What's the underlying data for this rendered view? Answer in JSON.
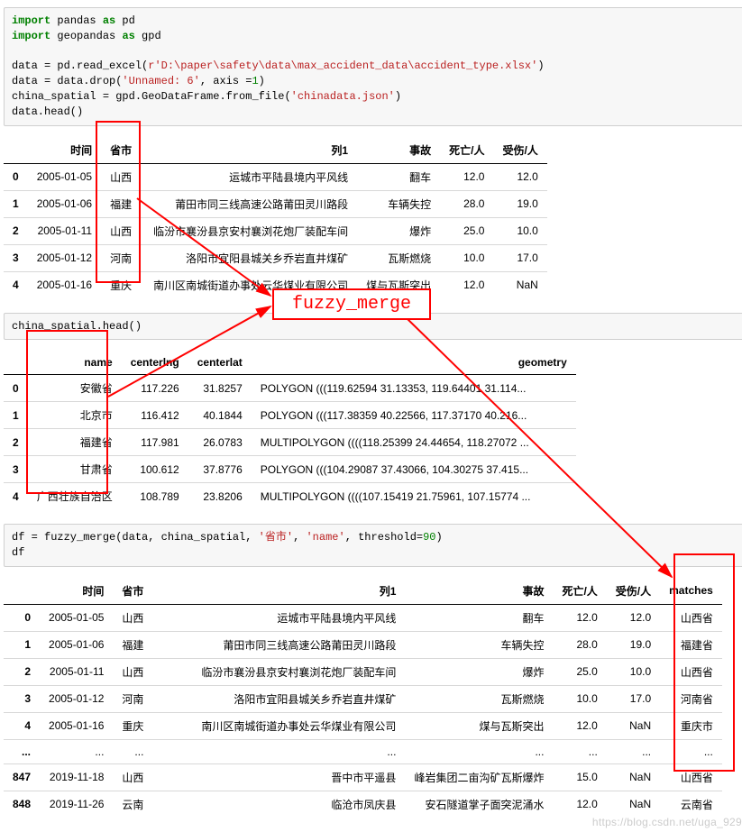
{
  "code1": {
    "line1a": "import",
    "line1b": " pandas ",
    "line1c": "as",
    "line1d": " pd",
    "line2a": "import",
    "line2b": " geopandas ",
    "line2c": "as",
    "line2d": " gpd",
    "line3a": "data = pd.read_excel(",
    "line3r": "r",
    "line3s": "'D:\\paper\\safety\\data\\max_accident_data\\accident_type.xlsx'",
    "line3b": ")",
    "line4a": "data = data.drop(",
    "line4s": "'Unnamed: 6'",
    "line4b": ", axis =",
    "line4n": "1",
    "line4c": ")",
    "line5a": "china_spatial = gpd.GeoDataFrame.from_file(",
    "line5s": "'chinadata.json'",
    "line5b": ")",
    "line6": "data.head()"
  },
  "table1": {
    "headers": [
      "",
      "时间",
      "省市",
      "列1",
      "事故",
      "死亡/人",
      "受伤/人"
    ],
    "rows": [
      {
        "idx": "0",
        "c": [
          "2005-01-05",
          "山西",
          "运城市平陆县境内平风线",
          "翻车",
          "12.0",
          "12.0"
        ]
      },
      {
        "idx": "1",
        "c": [
          "2005-01-06",
          "福建",
          "莆田市同三线高速公路莆田灵川路段",
          "车辆失控",
          "28.0",
          "19.0"
        ]
      },
      {
        "idx": "2",
        "c": [
          "2005-01-11",
          "山西",
          "临汾市襄汾县京安村襄浏花炮厂装配车间",
          "爆炸",
          "25.0",
          "10.0"
        ]
      },
      {
        "idx": "3",
        "c": [
          "2005-01-12",
          "河南",
          "洛阳市宜阳县城关乡乔岩直井煤矿",
          "瓦斯燃烧",
          "10.0",
          "17.0"
        ]
      },
      {
        "idx": "4",
        "c": [
          "2005-01-16",
          "重庆",
          "南川区南城街道办事处云华煤业有限公司",
          "煤与瓦斯突出",
          "12.0",
          "NaN"
        ]
      }
    ]
  },
  "code2": "china_spatial.head()",
  "table2": {
    "headers": [
      "",
      "name",
      "centerlng",
      "centerlat",
      "geometry"
    ],
    "rows": [
      {
        "idx": "0",
        "c": [
          "安徽省",
          "117.226",
          "31.8257",
          "POLYGON (((119.62594 31.13353, 119.64401 31.114..."
        ]
      },
      {
        "idx": "1",
        "c": [
          "北京市",
          "116.412",
          "40.1844",
          "POLYGON (((117.38359 40.22566, 117.37170 40.216..."
        ]
      },
      {
        "idx": "2",
        "c": [
          "福建省",
          "117.981",
          "26.0783",
          "MULTIPOLYGON ((((118.25399 24.44654, 118.27072 ..."
        ]
      },
      {
        "idx": "3",
        "c": [
          "甘肃省",
          "100.612",
          "37.8776",
          "POLYGON (((104.29087 37.43066, 104.30275 37.415..."
        ]
      },
      {
        "idx": "4",
        "c": [
          "广西壮族自治区",
          "108.789",
          "23.8206",
          "MULTIPOLYGON ((((107.15419 21.75961, 107.15774 ..."
        ]
      }
    ]
  },
  "code3": {
    "linea": "df = fuzzy_merge(data, china_spatial, ",
    "s1": "'省市'",
    "sep1": ", ",
    "s2": "'name'",
    "sep2": ", threshold=",
    "n": "90",
    "lineb": ")",
    "line2": "df"
  },
  "table3": {
    "headers": [
      "",
      "时间",
      "省市",
      "列1",
      "事故",
      "死亡/人",
      "受伤/人",
      "matches"
    ],
    "rows": [
      {
        "idx": "0",
        "c": [
          "2005-01-05",
          "山西",
          "运城市平陆县境内平风线",
          "翻车",
          "12.0",
          "12.0",
          "山西省"
        ]
      },
      {
        "idx": "1",
        "c": [
          "2005-01-06",
          "福建",
          "莆田市同三线高速公路莆田灵川路段",
          "车辆失控",
          "28.0",
          "19.0",
          "福建省"
        ]
      },
      {
        "idx": "2",
        "c": [
          "2005-01-11",
          "山西",
          "临汾市襄汾县京安村襄浏花炮厂装配车间",
          "爆炸",
          "25.0",
          "10.0",
          "山西省"
        ]
      },
      {
        "idx": "3",
        "c": [
          "2005-01-12",
          "河南",
          "洛阳市宜阳县城关乡乔岩直井煤矿",
          "瓦斯燃烧",
          "10.0",
          "17.0",
          "河南省"
        ]
      },
      {
        "idx": "4",
        "c": [
          "2005-01-16",
          "重庆",
          "南川区南城街道办事处云华煤业有限公司",
          "煤与瓦斯突出",
          "12.0",
          "NaN",
          "重庆市"
        ]
      },
      {
        "idx": "...",
        "c": [
          "...",
          "...",
          "...",
          "...",
          "...",
          "...",
          "..."
        ]
      },
      {
        "idx": "847",
        "c": [
          "2019-11-18",
          "山西",
          "晋中市平遥县",
          "峰岩集团二亩沟矿瓦斯爆炸",
          "15.0",
          "NaN",
          "山西省"
        ]
      },
      {
        "idx": "848",
        "c": [
          "2019-11-26",
          "云南",
          "临沧市凤庆县",
          "安石隧道掌子面突泥涌水",
          "12.0",
          "NaN",
          "云南省"
        ]
      }
    ]
  },
  "annotations": {
    "fuzzy_merge": "fuzzy_merge",
    "watermark": "https://blog.csdn.net/uga_929"
  }
}
